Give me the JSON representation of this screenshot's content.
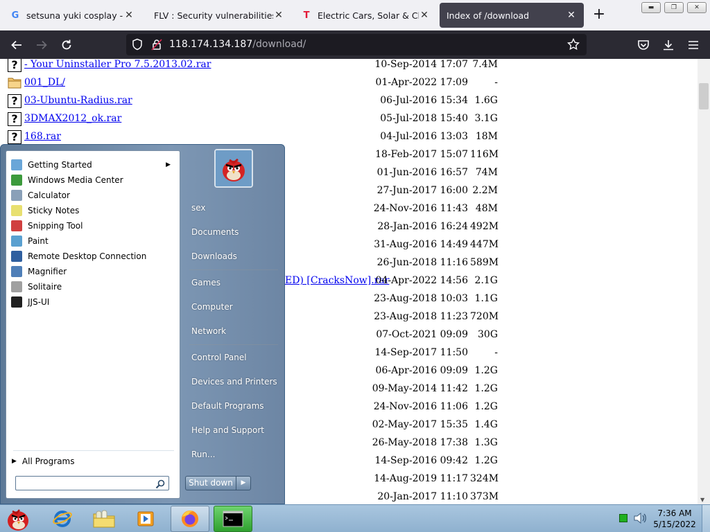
{
  "browser": {
    "tabs": [
      {
        "title": "setsuna yuki cosplay - Googl",
        "favicon": "google-g-icon",
        "active": false
      },
      {
        "title": "FLV : Security vulnerabilities",
        "favicon": "none",
        "active": false
      },
      {
        "title": "Electric Cars, Solar & Clean E",
        "favicon": "tesla-icon",
        "active": false
      },
      {
        "title": "Index of /download",
        "favicon": "none",
        "active": true
      }
    ],
    "url_host": "118.174.134.187",
    "url_path": "/download/"
  },
  "listing": {
    "rows": [
      {
        "name": "- Your Uninstaller Pro 7.5.2013.02.rar",
        "date": "10-Sep-2014 17:07",
        "size": "7.4M",
        "icon": "unknown-file-icon"
      },
      {
        "name": "001_DL/",
        "date": "01-Apr-2022 17:09",
        "size": "-",
        "icon": "folder-icon"
      },
      {
        "name": "03-Ubuntu-Radius.rar",
        "date": "06-Jul-2016 15:34",
        "size": "1.6G",
        "icon": "unknown-file-icon"
      },
      {
        "name": "3DMAX2012_ok.rar",
        "date": "05-Jul-2018 15:40",
        "size": "3.1G",
        "icon": "unknown-file-icon"
      },
      {
        "name": "168.rar",
        "date": "04-Jul-2016 13:03",
        "size": "18M",
        "icon": "unknown-file-icon"
      },
      {
        "name": "",
        "date": "18-Feb-2017 15:07",
        "size": "116M",
        "icon": ""
      },
      {
        "name": "",
        "date": "01-Jun-2016 16:57",
        "size": "74M",
        "icon": ""
      },
      {
        "name": "",
        "date": "27-Jun-2017 16:00",
        "size": "2.2M",
        "icon": ""
      },
      {
        "name": "",
        "date": "24-Nov-2016 11:43",
        "size": "48M",
        "icon": ""
      },
      {
        "name": "",
        "date": "28-Jan-2016 16:24",
        "size": "492M",
        "icon": ""
      },
      {
        "name": "",
        "date": "31-Aug-2016 14:49",
        "size": "447M",
        "icon": ""
      },
      {
        "name": "",
        "date": "26-Jun-2018 11:16",
        "size": "589M",
        "icon": ""
      },
      {
        "name": "ED) [CracksNow].rar",
        "date": "04-Apr-2022 14:56",
        "size": "2.1G",
        "icon": ""
      },
      {
        "name": "",
        "date": "23-Aug-2018 10:03",
        "size": "1.1G",
        "icon": ""
      },
      {
        "name": "",
        "date": "23-Aug-2018 11:23",
        "size": "720M",
        "icon": ""
      },
      {
        "name": "",
        "date": "07-Oct-2021 09:09",
        "size": "30G",
        "icon": ""
      },
      {
        "name": "",
        "date": "14-Sep-2017 11:50",
        "size": "-",
        "icon": ""
      },
      {
        "name": "",
        "date": "06-Apr-2016 09:09",
        "size": "1.2G",
        "icon": ""
      },
      {
        "name": "",
        "date": "09-May-2014 11:42",
        "size": "1.2G",
        "icon": ""
      },
      {
        "name": "",
        "date": "24-Nov-2016 11:06",
        "size": "1.2G",
        "icon": ""
      },
      {
        "name": "",
        "date": "02-May-2017 15:35",
        "size": "1.4G",
        "icon": ""
      },
      {
        "name": "",
        "date": "26-May-2018 17:38",
        "size": "1.3G",
        "icon": ""
      },
      {
        "name": "",
        "date": "14-Sep-2016 09:42",
        "size": "1.2G",
        "icon": ""
      },
      {
        "name": "",
        "date": "14-Aug-2019 11:17",
        "size": "324M",
        "icon": ""
      },
      {
        "name": "",
        "date": "20-Jan-2017 11:10",
        "size": "373M",
        "icon": ""
      }
    ]
  },
  "start_menu": {
    "programs": [
      {
        "label": "Getting Started",
        "icon": "getting-started-icon",
        "color": "#6aa6d8",
        "submenu": true
      },
      {
        "label": "Windows Media Center",
        "icon": "media-center-icon",
        "color": "#3c9a3c",
        "submenu": false
      },
      {
        "label": "Calculator",
        "icon": "calculator-icon",
        "color": "#8aa0b8",
        "submenu": false
      },
      {
        "label": "Sticky Notes",
        "icon": "sticky-notes-icon",
        "color": "#e8e070",
        "submenu": false
      },
      {
        "label": "Snipping Tool",
        "icon": "snipping-tool-icon",
        "color": "#d04040",
        "submenu": false
      },
      {
        "label": "Paint",
        "icon": "paint-icon",
        "color": "#5aa0d0",
        "submenu": false
      },
      {
        "label": "Remote Desktop Connection",
        "icon": "remote-desktop-icon",
        "color": "#2f5f9f",
        "submenu": false
      },
      {
        "label": "Magnifier",
        "icon": "magnifier-icon",
        "color": "#4f7fb8",
        "submenu": false
      },
      {
        "label": "Solitaire",
        "icon": "solitaire-icon",
        "color": "#a0a0a0",
        "submenu": false
      },
      {
        "label": "JJS-UI",
        "icon": "jjs-ui-icon",
        "color": "#202020",
        "submenu": false
      }
    ],
    "all_programs": "All Programs",
    "user_name": "sex",
    "right_items_group1": [
      "Documents",
      "Downloads"
    ],
    "right_items_group2": [
      "Games",
      "Computer",
      "Network"
    ],
    "right_items_group3": [
      "Control Panel",
      "Devices and Printers",
      "Default Programs",
      "Help and Support",
      "Run..."
    ],
    "shutdown_label": "Shut down"
  },
  "taskbar": {
    "time": "7:36 AM",
    "date": "5/15/2022"
  },
  "colors": {
    "link": "#0000ee",
    "browser_dark": "#2b2a33",
    "active_tab": "#42414d"
  }
}
